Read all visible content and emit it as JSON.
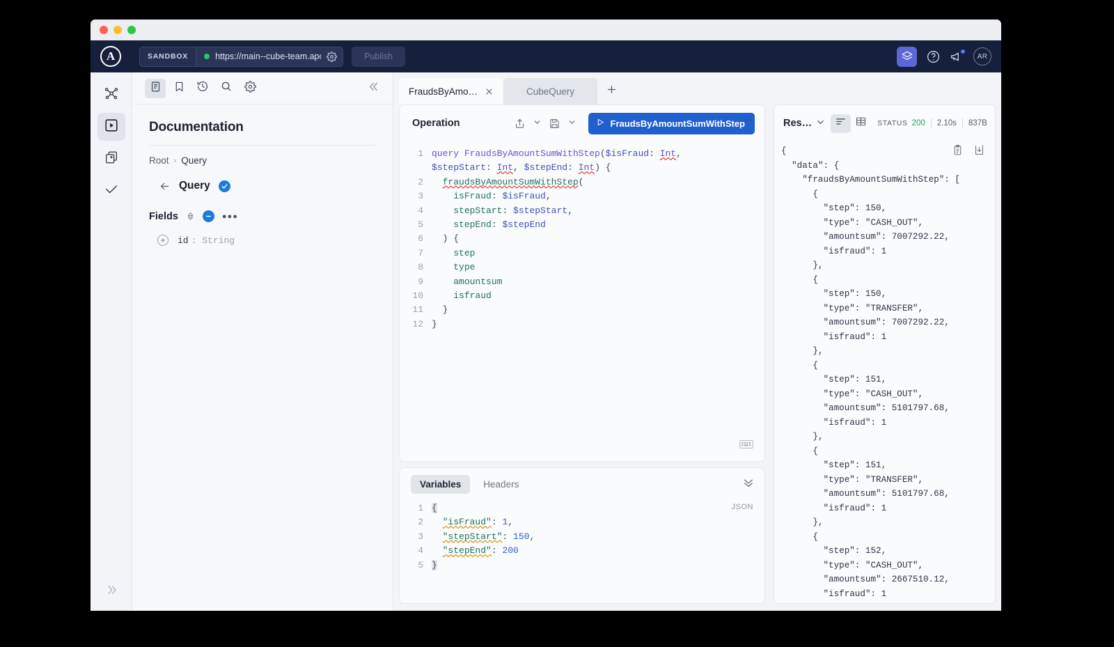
{
  "topnav": {
    "logo": "apollo-logo",
    "sandbox_label": "SANDBOX",
    "url": "https://main--cube-team.apol",
    "publish_label": "Publish",
    "avatar_initials": "AR"
  },
  "rail": {
    "items": [
      {
        "name": "schema-graph",
        "icon": "graph-icon"
      },
      {
        "name": "explorer",
        "icon": "play-square-icon",
        "active": true
      },
      {
        "name": "collections",
        "icon": "documents-icon"
      },
      {
        "name": "checks",
        "icon": "check-icon"
      }
    ],
    "expand_icon": "chevron-double-right-icon"
  },
  "docs": {
    "toolbar": [
      {
        "name": "documentation",
        "icon": "doc-icon",
        "active": true
      },
      {
        "name": "bookmarks",
        "icon": "bookmark-icon"
      },
      {
        "name": "history",
        "icon": "history-icon"
      },
      {
        "name": "search",
        "icon": "search-icon"
      },
      {
        "name": "settings",
        "icon": "gear-icon"
      }
    ],
    "collapse_icon": "chevron-double-left-icon",
    "title": "Documentation",
    "breadcrumb": [
      "Root",
      "Query"
    ],
    "current_type": "Query",
    "fields_label": "Fields",
    "fields": [
      {
        "name": "id",
        "type": "String"
      }
    ]
  },
  "tabs": {
    "items": [
      {
        "label": "FraudsByAmo…",
        "active": true,
        "closable": true
      },
      {
        "label": "CubeQuery",
        "active": false,
        "closable": false
      }
    ],
    "add_label": "+"
  },
  "operation": {
    "title": "Operation",
    "share_icon": "share-icon",
    "save_icon": "save-icon",
    "run_label": "FraudsByAmountSumWithStep",
    "more_label": "•••",
    "keyboard_icon": "keyboard-icon",
    "lines": [
      {
        "n": "1",
        "segments": [
          {
            "t": "query ",
            "c": "kw"
          },
          {
            "t": "FraudsByAmountSumWithStep",
            "c": "opname"
          },
          {
            "t": "(",
            "c": "punc"
          },
          {
            "t": "$isFraud",
            "c": "var"
          },
          {
            "t": ": ",
            "c": "punc"
          },
          {
            "t": "Int",
            "c": "type squig"
          },
          {
            "t": ",",
            "c": "punc"
          }
        ]
      },
      {
        "n": "",
        "segments": [
          {
            "t": "$stepStart",
            "c": "var"
          },
          {
            "t": ": ",
            "c": "punc"
          },
          {
            "t": "Int",
            "c": "type squig"
          },
          {
            "t": ", ",
            "c": "punc"
          },
          {
            "t": "$stepEnd",
            "c": "var"
          },
          {
            "t": ": ",
            "c": "punc"
          },
          {
            "t": "Int",
            "c": "type squig"
          },
          {
            "t": ") {",
            "c": "punc"
          }
        ]
      },
      {
        "n": "2",
        "segments": [
          {
            "t": "  ",
            "c": "punc"
          },
          {
            "t": "fraudsByAmountSumWithStep",
            "c": "fieldc squig"
          },
          {
            "t": "(",
            "c": "punc"
          }
        ]
      },
      {
        "n": "3",
        "segments": [
          {
            "t": "    ",
            "c": "punc"
          },
          {
            "t": "isFraud",
            "c": "fieldc"
          },
          {
            "t": ": ",
            "c": "punc"
          },
          {
            "t": "$isFraud",
            "c": "var"
          },
          {
            "t": ",",
            "c": "punc"
          }
        ]
      },
      {
        "n": "4",
        "segments": [
          {
            "t": "    ",
            "c": "punc"
          },
          {
            "t": "stepStart",
            "c": "fieldc"
          },
          {
            "t": ": ",
            "c": "punc"
          },
          {
            "t": "$stepStart",
            "c": "var"
          },
          {
            "t": ",",
            "c": "punc"
          }
        ]
      },
      {
        "n": "5",
        "segments": [
          {
            "t": "    ",
            "c": "punc"
          },
          {
            "t": "stepEnd",
            "c": "fieldc"
          },
          {
            "t": ": ",
            "c": "punc"
          },
          {
            "t": "$stepEnd",
            "c": "var"
          }
        ]
      },
      {
        "n": "6",
        "segments": [
          {
            "t": "  ) {",
            "c": "punc"
          }
        ]
      },
      {
        "n": "7",
        "segments": [
          {
            "t": "    ",
            "c": "punc"
          },
          {
            "t": "step",
            "c": "fieldc"
          }
        ]
      },
      {
        "n": "8",
        "segments": [
          {
            "t": "    ",
            "c": "punc"
          },
          {
            "t": "type",
            "c": "fieldc"
          }
        ]
      },
      {
        "n": "9",
        "segments": [
          {
            "t": "    ",
            "c": "punc"
          },
          {
            "t": "amountsum",
            "c": "fieldc"
          }
        ]
      },
      {
        "n": "10",
        "segments": [
          {
            "t": "    ",
            "c": "punc"
          },
          {
            "t": "isfraud",
            "c": "fieldc"
          }
        ]
      },
      {
        "n": "11",
        "segments": [
          {
            "t": "  }",
            "c": "punc"
          }
        ]
      },
      {
        "n": "12",
        "segments": [
          {
            "t": "}",
            "c": "punc"
          }
        ]
      }
    ]
  },
  "variables": {
    "tabs": [
      {
        "label": "Variables",
        "active": true
      },
      {
        "label": "Headers",
        "active": false
      }
    ],
    "collapse_icon": "chevron-double-down-icon",
    "format_label": "JSON",
    "lines": [
      {
        "n": "1",
        "segments": [
          {
            "t": "{",
            "c": "punc brace-hl"
          }
        ]
      },
      {
        "n": "2",
        "segments": [
          {
            "t": "  ",
            "c": "punc"
          },
          {
            "t": "\"isFraud\"",
            "c": "jkey squig-y"
          },
          {
            "t": ": ",
            "c": "punc"
          },
          {
            "t": "1",
            "c": "jnum"
          },
          {
            "t": ",",
            "c": "punc"
          }
        ]
      },
      {
        "n": "3",
        "segments": [
          {
            "t": "  ",
            "c": "punc"
          },
          {
            "t": "\"stepStart\"",
            "c": "jkey squig-y"
          },
          {
            "t": ": ",
            "c": "punc"
          },
          {
            "t": "150",
            "c": "jnum"
          },
          {
            "t": ",",
            "c": "punc"
          }
        ]
      },
      {
        "n": "4",
        "segments": [
          {
            "t": "  ",
            "c": "punc"
          },
          {
            "t": "\"stepEnd\"",
            "c": "jkey squig-y"
          },
          {
            "t": ": ",
            "c": "punc"
          },
          {
            "t": "200",
            "c": "jnum"
          }
        ]
      },
      {
        "n": "5",
        "segments": [
          {
            "t": "}",
            "c": "punc brace-hl"
          }
        ]
      }
    ]
  },
  "response": {
    "title": "Res…",
    "chevron_icon": "chevron-down-icon",
    "views": [
      {
        "name": "json-view",
        "icon": "lines-icon",
        "active": true
      },
      {
        "name": "table-view",
        "icon": "table-icon",
        "active": false
      }
    ],
    "status_label": "STATUS",
    "status_code": "200",
    "duration": "2.10s",
    "size": "837B",
    "copy_icon": "clipboard-icon",
    "download_icon": "download-icon",
    "json_text": "{\n  \"data\": {\n    \"fraudsByAmountSumWithStep\": [\n      {\n        \"step\": 150,\n        \"type\": \"CASH_OUT\",\n        \"amountsum\": 7007292.22,\n        \"isfraud\": 1\n      },\n      {\n        \"step\": 150,\n        \"type\": \"TRANSFER\",\n        \"amountsum\": 7007292.22,\n        \"isfraud\": 1\n      },\n      {\n        \"step\": 151,\n        \"type\": \"CASH_OUT\",\n        \"amountsum\": 5101797.68,\n        \"isfraud\": 1\n      },\n      {\n        \"step\": 151,\n        \"type\": \"TRANSFER\",\n        \"amountsum\": 5101797.68,\n        \"isfraud\": 1\n      },\n      {\n        \"step\": 152,\n        \"type\": \"CASH_OUT\",\n        \"amountsum\": 2667510.12,\n        \"isfraud\": 1",
    "records": [
      {
        "step": 150,
        "type": "CASH_OUT",
        "amountsum": 7007292.22,
        "isfraud": 1
      },
      {
        "step": 150,
        "type": "TRANSFER",
        "amountsum": 7007292.22,
        "isfraud": 1
      },
      {
        "step": 151,
        "type": "CASH_OUT",
        "amountsum": 5101797.68,
        "isfraud": 1
      },
      {
        "step": 151,
        "type": "TRANSFER",
        "amountsum": 5101797.68,
        "isfraud": 1
      },
      {
        "step": 152,
        "type": "CASH_OUT",
        "amountsum": 2667510.12,
        "isfraud": 1
      }
    ]
  },
  "colors": {
    "nav_bg": "#16203c",
    "accent": "#1f5fd0",
    "status_ok": "#21a35c",
    "cube_btn": "#5b68d6"
  }
}
